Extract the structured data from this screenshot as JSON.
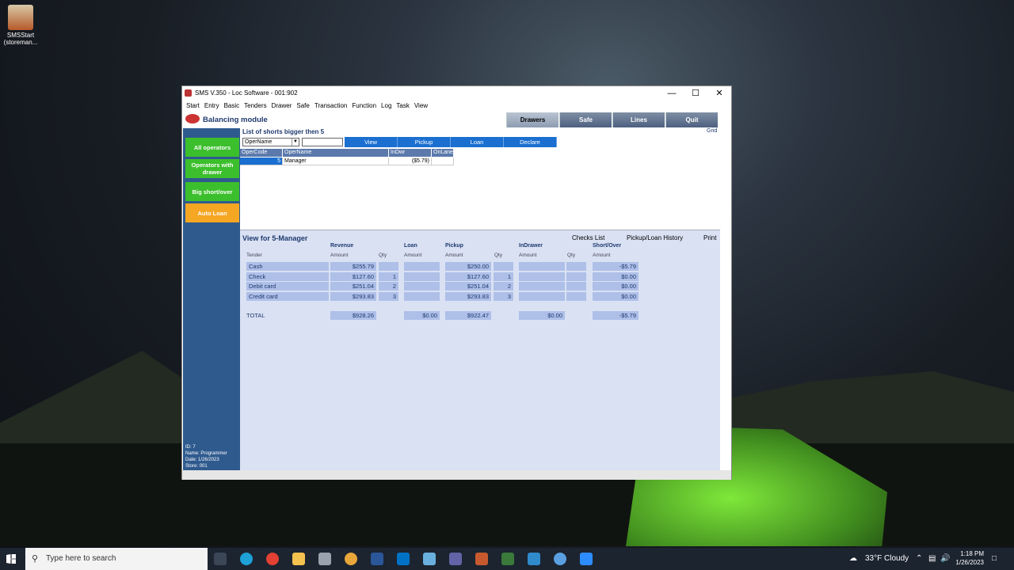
{
  "desktop": {
    "icon_label": "SMSStart (storeman..."
  },
  "window": {
    "title": "SMS V.350 - Loc Software - 001:902",
    "minimize": "—",
    "maximize": "☐",
    "close": "✕"
  },
  "menu": [
    "Start",
    "Entry",
    "Basic",
    "Tenders",
    "Drawer",
    "Safe",
    "Transaction",
    "Function",
    "Log",
    "Task",
    "View"
  ],
  "header": {
    "title": "Balancing module",
    "tabs": [
      "Drawers",
      "Safe",
      "Lines",
      "Quit"
    ]
  },
  "sidebar": {
    "buttons": [
      "All operators",
      "Operators with drawer",
      "Big short/over",
      "Auto Loan"
    ],
    "info": [
      {
        "label": "ID:",
        "value": "7"
      },
      {
        "label": "Name:",
        "value": "Programmer"
      },
      {
        "label": "Date:",
        "value": "1/26/2023"
      },
      {
        "label": "Store:",
        "value": "001"
      }
    ]
  },
  "list": {
    "title": "List of shorts bigger then 5",
    "grid_link": "Grid",
    "select_value": "OperName",
    "text_value": "",
    "buttons": [
      "View",
      "Pickup",
      "Loan",
      "Declare"
    ],
    "headers": [
      "OperCode",
      "OperName",
      "InDwr",
      "OnLane"
    ],
    "rows": [
      {
        "code": "5",
        "name": "Manager",
        "indwr": "($5.79)",
        "onlane": ""
      }
    ]
  },
  "view": {
    "title": "View for 5-Manager",
    "links": [
      "Checks List",
      "Pickup/Loan History",
      "Print"
    ],
    "groups": [
      "Revenue",
      "Loan",
      "Pickup",
      "InDrawer",
      "Short/Over"
    ],
    "sub": {
      "tender": "Tender",
      "amount": "Amount",
      "qty": "Qty"
    },
    "rows": [
      {
        "tender": "Cash",
        "rev": "$255.79",
        "rev_qty": "",
        "loan": "",
        "pickup": "$250.00",
        "pick_qty": "",
        "indrawer": "",
        "ind_qty": "",
        "short": "-$5.79"
      },
      {
        "tender": "Check",
        "rev": "$127.60",
        "rev_qty": "1",
        "loan": "",
        "pickup": "$127.60",
        "pick_qty": "1",
        "indrawer": "",
        "ind_qty": "",
        "short": "$0.00"
      },
      {
        "tender": "Debit card",
        "rev": "$251.04",
        "rev_qty": "2",
        "loan": "",
        "pickup": "$251.04",
        "pick_qty": "2",
        "indrawer": "",
        "ind_qty": "",
        "short": "$0.00"
      },
      {
        "tender": "Credit card",
        "rev": "$293.83",
        "rev_qty": "3",
        "loan": "",
        "pickup": "$293.83",
        "pick_qty": "3",
        "indrawer": "",
        "ind_qty": "",
        "short": "$0.00"
      }
    ],
    "total": {
      "label": "TOTAL",
      "rev": "$928.26",
      "loan": "$0.00",
      "pickup": "$922.47",
      "indrawer": "$0.00",
      "short": "-$5.79"
    }
  },
  "taskbar": {
    "search_placeholder": "Type here to search",
    "weather": "33°F  Cloudy",
    "time": "1:18 PM",
    "date": "1/26/2023"
  }
}
